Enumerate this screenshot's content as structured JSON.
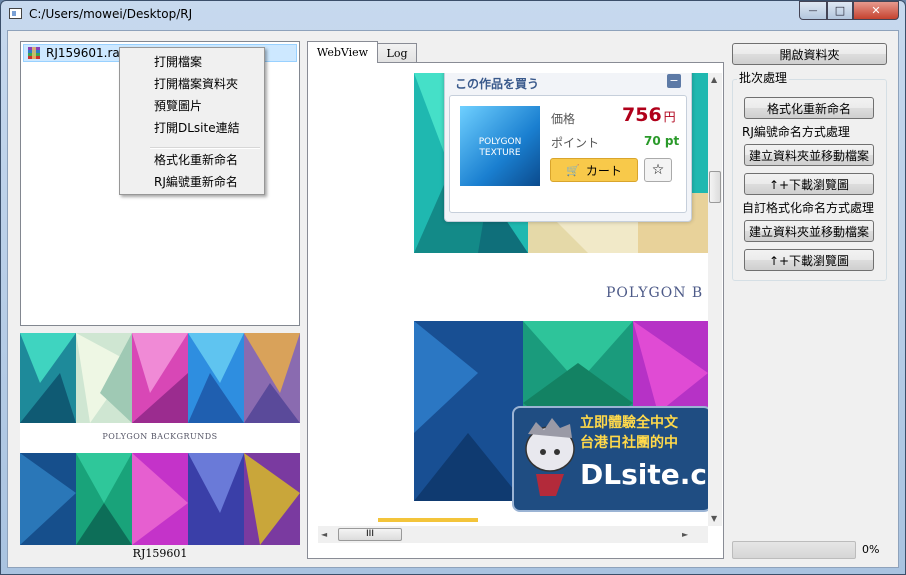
{
  "window": {
    "title": "C:/Users/mowei/Desktop/RJ",
    "min_glyph": "—",
    "max_glyph": "□",
    "close_glyph": "✕"
  },
  "file_list": {
    "items": [
      {
        "label": "RJ159601.rar"
      }
    ]
  },
  "context_menu": {
    "items": [
      "打開檔案",
      "打開檔案資料夾",
      "預覽圖片",
      "打開DLsite連結"
    ],
    "items2": [
      "格式化重新命名",
      "RJ編號重新命名"
    ]
  },
  "preview": {
    "banner_text": "POLYGON BACKGRUNDS",
    "caption": "RJ159601"
  },
  "tabs": [
    {
      "label": "WebView"
    },
    {
      "label": "Log"
    }
  ],
  "webview": {
    "purchase_title": "この作品を買う",
    "collapse_glyph": "−",
    "thumb_line1": "POLYGON",
    "thumb_line2": "TEXTURE",
    "price_label": "価格",
    "price_value": "756",
    "price_unit": "円",
    "point_label": "ポイント",
    "point_value": "70 pt",
    "cart_label": "カート",
    "star_glyph": "☆",
    "mid_banner": "POLYGON B",
    "dl_line1": "立即體驗全中文",
    "dl_line2": "台港日社團的中",
    "dl_logo": "DLsite.c"
  },
  "scroll": {
    "thumb_glyph": "III",
    "up": "▲",
    "down": "▼",
    "left": "◄",
    "right": "►"
  },
  "right_panel": {
    "open_folder": "開啟資料夾",
    "batch_title": "批次處理",
    "format_rename": "格式化重新命名",
    "rj_label": "RJ編號命名方式處理",
    "rj_create": "建立資料夾並移動檔案",
    "rj_download": "↑+下載瀏覽圖",
    "custom_label": "自訂格式化命名方式處理",
    "custom_create": "建立資料夾並移動檔案",
    "custom_download": "↑+下載瀏覽圖"
  },
  "progress": {
    "value": 0,
    "text": "0%"
  }
}
